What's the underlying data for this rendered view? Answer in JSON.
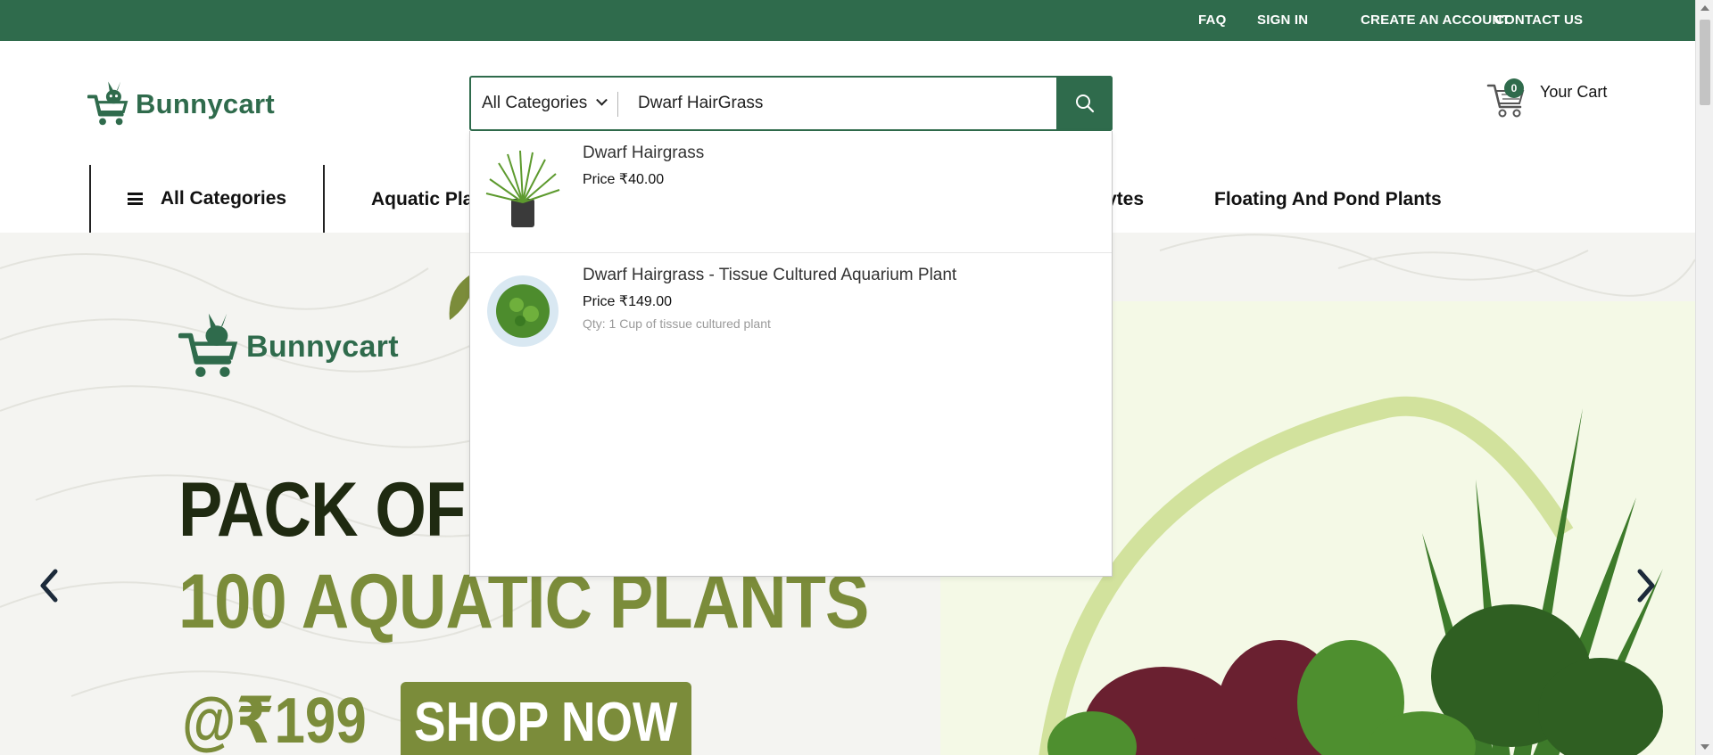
{
  "topbar": {
    "links": [
      "FAQ",
      "SIGN IN",
      "CREATE AN ACCOUNT",
      "CONTACT US"
    ]
  },
  "brand": {
    "name": "Bunnycart",
    "color": "#2f6b4c"
  },
  "search": {
    "category": "All Categories",
    "value": "Dwarf HairGrass"
  },
  "cart": {
    "count": "0",
    "label": "Your Cart"
  },
  "nav": {
    "all_categories": "All Categories",
    "items": [
      "Aquatic Pla",
      "ytes",
      "Floating And Pond Plants"
    ]
  },
  "results": [
    {
      "name": "Dwarf Hairgrass",
      "price": "Price ₹40.00",
      "qty": ""
    },
    {
      "name": "Dwarf Hairgrass - Tissue Cultured Aquarium Plant",
      "price": "Price ₹149.00",
      "qty": "Qty: 1 Cup of tissue cultured plant"
    }
  ],
  "hero": {
    "logo_text": "Bunnycart",
    "line1": "PACK OF",
    "line2": "100 AQUATIC PLANTS",
    "price": "@₹199",
    "button": "SHOP NOW",
    "colors": {
      "dark": "#1f2a11",
      "olive": "#7b8c3a"
    }
  }
}
